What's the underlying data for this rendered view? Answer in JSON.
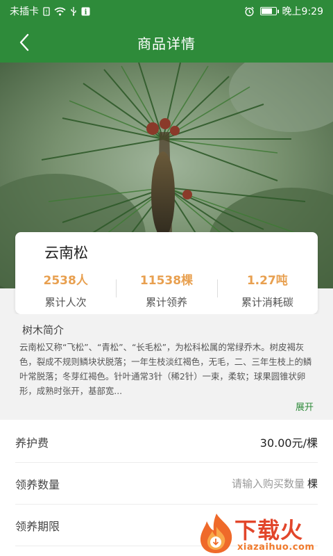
{
  "status_bar": {
    "carrier": "未插卡",
    "time": "晚上9:29"
  },
  "header": {
    "title": "商品详情"
  },
  "icons": [
    "back-arrow-icon",
    "alarm-icon",
    "wifi-icon",
    "usb-icon",
    "info-icon",
    "battery-icon",
    "sim-icon"
  ],
  "colors": {
    "theme_green": "#2e8b3a",
    "stat_orange": "#e8a050",
    "watermark_red": "#e2462b"
  },
  "tree": {
    "name": "云南松"
  },
  "stats": [
    {
      "value": "2538人",
      "label": "累计人次"
    },
    {
      "value": "11538棵",
      "label": "累计领养"
    },
    {
      "value": "1.27吨",
      "label": "累计消耗碳"
    }
  ],
  "intro": {
    "title": "树木简介",
    "text": "云南松又称“飞松”、“青松”、“长毛松”，为松科松属的常绿乔木。树皮褐灰色，裂成不规则鳞块状脱落；一年生枝淡红褐色，无毛，二、三年生枝上的鳞叶常脱落；冬芽红褐色。针叶通常3针（稀2针）一束，柔软；球果圆锥状卵形，成熟时张开，基部宽...",
    "expand_label": "展开"
  },
  "fee": {
    "label": "养护费",
    "value": "30.00元/棵"
  },
  "quantity": {
    "label": "领养数量",
    "placeholder": "请输入购买数量",
    "unit": "棵"
  },
  "period": {
    "label": "领养期限"
  },
  "watermark": {
    "text": "下载火",
    "url": "xiazaihuo.com"
  }
}
